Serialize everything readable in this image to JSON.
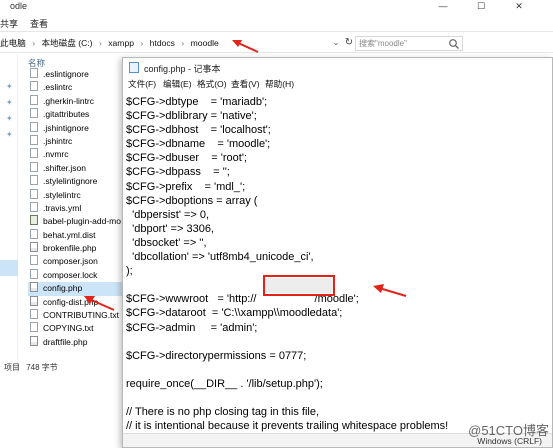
{
  "explorer": {
    "title_fragment": "odle",
    "ribbon_tabs": [
      "共享",
      "查看"
    ],
    "address": {
      "segments": [
        "此电脑",
        "本地磁盘 (C:)",
        "xampp",
        "htdocs",
        "moodle"
      ],
      "separator": "›"
    },
    "search_placeholder": "搜索\"moodle\"",
    "column_header": "名称",
    "files": [
      ".eslintignore",
      ".eslintrc",
      ".gherkin-lintrc",
      ".gitattributes",
      ".jshintignore",
      ".jshintrc",
      ".nvmrc",
      ".shifter.json",
      ".stylelintignore",
      ".stylelintrc",
      ".travis.yml",
      "babel-plugin-add-mo",
      "behat.yml.dist",
      "brokenfile.php",
      "composer.json",
      "composer.lock",
      "config.php",
      "config-dist.php",
      "CONTRIBUTING.txt",
      "COPYING.txt",
      "draftfile.php"
    ],
    "selected_file_index": 16,
    "status": {
      "items_label": "项目",
      "size": "748 字节"
    },
    "window_controls": [
      "—",
      "☐",
      "✕"
    ]
  },
  "notepad": {
    "title": "config.php - 记事本",
    "menu": [
      "文件(F)",
      "编辑(E)",
      "格式(O)",
      "查看(V)",
      "帮助(H)"
    ],
    "lines": [
      "$CFG->dbtype    = 'mariadb';",
      "$CFG->dblibrary = 'native';",
      "$CFG->dbhost    = 'localhost';",
      "$CFG->dbname    = 'moodle';",
      "$CFG->dbuser    = 'root';",
      "$CFG->dbpass    = '';",
      "$CFG->prefix    = 'mdl_';",
      "$CFG->dboptions = array (",
      "  'dbpersist' => 0,",
      "  'dbport' => 3306,",
      "  'dbsocket' => '',",
      "  'dbcollation' => 'utf8mb4_unicode_ci',",
      ");",
      "",
      "$CFG->wwwroot   = 'http://                   /moodle';",
      "$CFG->dataroot  = 'C:\\\\xampp\\\\moodledata';",
      "$CFG->admin     = 'admin';",
      "",
      "$CFG->directorypermissions = 0777;",
      "",
      "require_once(__DIR__ . '/lib/setup.php');",
      "",
      "// There is no php closing tag in this file,",
      "// it is intentional because it prevents trailing whitespace problems!"
    ],
    "status_encoding": "Windows (CRLF)"
  },
  "watermark": "@51CTO博客",
  "colors": {
    "annotation_red": "#e2231a",
    "selection_blue": "#cce4f7"
  }
}
